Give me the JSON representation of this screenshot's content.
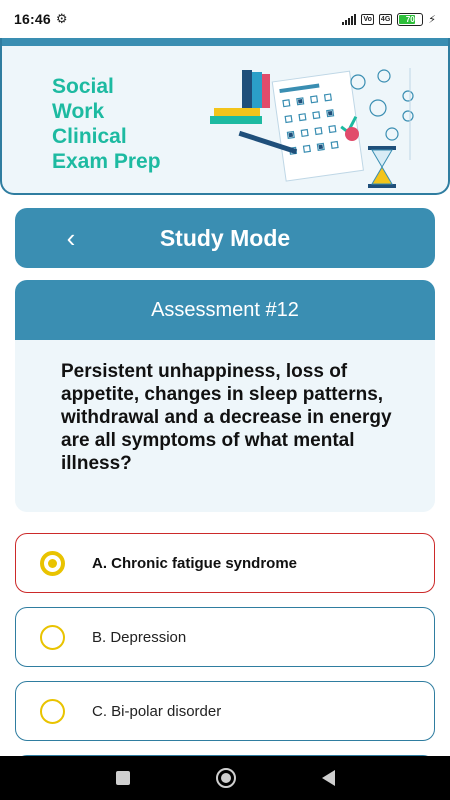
{
  "status_bar": {
    "time": "16:46",
    "network": "4G",
    "battery_level": "70",
    "battery_percent": 70
  },
  "header": {
    "app_title": "Social\nWork\nClinical\nExam Prep"
  },
  "study_bar": {
    "title": "Study Mode",
    "back_icon": "chevron-left-icon"
  },
  "question": {
    "number_label": "Assessment #12",
    "text": "Persistent unhappiness, loss of appetite, changes in sleep patterns, withdrawal and a decrease in energy are all symptoms of what mental illness?"
  },
  "options": [
    {
      "label": "A. Chronic fatigue syndrome",
      "selected": true
    },
    {
      "label": "B. Depression",
      "selected": false
    },
    {
      "label": "C. Bi-polar disorder",
      "selected": false
    }
  ],
  "colors": {
    "primary": "#3a8eb2",
    "title_teal": "#1dbaa1",
    "selected_border": "#cc2a2a",
    "radio_yellow": "#e9c300",
    "card_bg": "#eef6fa"
  }
}
